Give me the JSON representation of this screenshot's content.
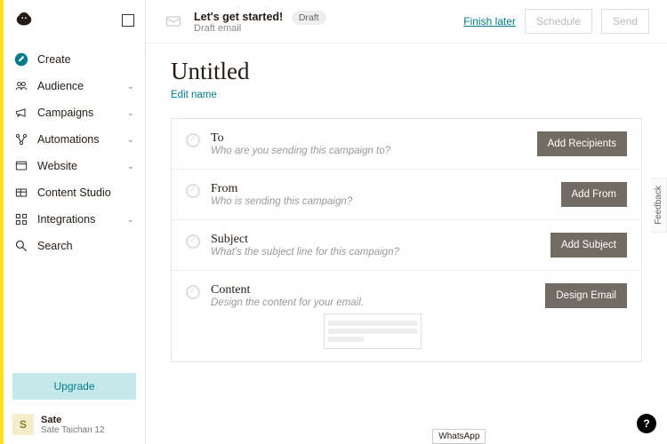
{
  "sidebar": {
    "items": [
      {
        "label": "Create",
        "icon": "pencil",
        "active": true,
        "expandable": false
      },
      {
        "label": "Audience",
        "icon": "audience",
        "active": false,
        "expandable": true
      },
      {
        "label": "Campaigns",
        "icon": "megaphone",
        "active": false,
        "expandable": true
      },
      {
        "label": "Automations",
        "icon": "automations",
        "active": false,
        "expandable": true
      },
      {
        "label": "Website",
        "icon": "website",
        "active": false,
        "expandable": true
      },
      {
        "label": "Content Studio",
        "icon": "content",
        "active": false,
        "expandable": false
      },
      {
        "label": "Integrations",
        "icon": "integrations",
        "active": false,
        "expandable": true
      },
      {
        "label": "Search",
        "icon": "search",
        "active": false,
        "expandable": false
      }
    ],
    "upgrade_label": "Upgrade",
    "user": {
      "initial": "S",
      "name": "Sate",
      "sub": "Sate Taichan 12"
    }
  },
  "topbar": {
    "title": "Let's get started!",
    "badge": "Draft",
    "subtitle": "Draft email",
    "finish_label": "Finish later",
    "schedule_label": "Schedule",
    "send_label": "Send"
  },
  "page": {
    "title": "Untitled",
    "edit_name": "Edit name"
  },
  "rows": [
    {
      "title": "To",
      "desc": "Who are you sending this campaign to?",
      "button": "Add Recipients"
    },
    {
      "title": "From",
      "desc": "Who is sending this campaign?",
      "button": "Add From"
    },
    {
      "title": "Subject",
      "desc": "What's the subject line for this campaign?",
      "button": "Add Subject"
    },
    {
      "title": "Content",
      "desc": "Design the content for your email.",
      "button": "Design Email"
    }
  ],
  "feedback_label": "Feedback",
  "footer_pill": "WhatsApp",
  "help_label": "?"
}
